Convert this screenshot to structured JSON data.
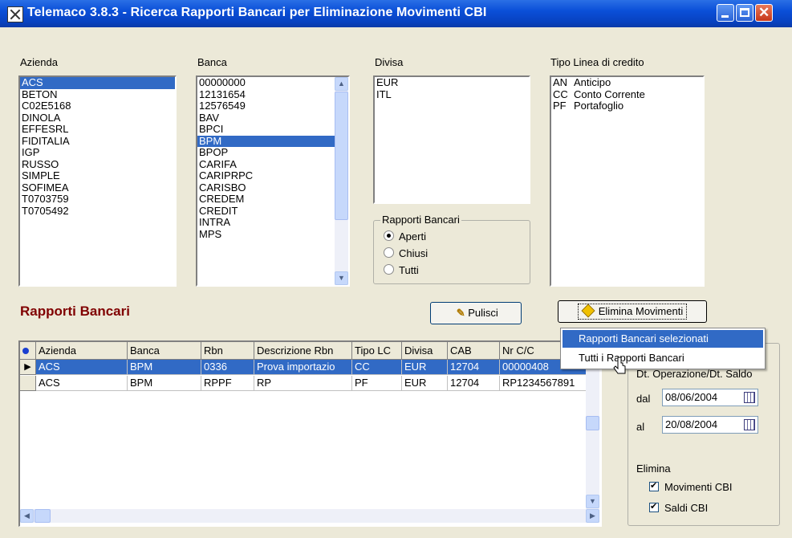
{
  "window": {
    "title": "Telemaco 3.8.3  - Ricerca Rapporti Bancari per Eliminazione Movimenti CBI"
  },
  "azienda": {
    "label": "Azienda",
    "items": [
      "ACS",
      "BETON",
      "C02E5168",
      "DINOLA",
      "EFFESRL",
      "FIDITALIA",
      "IGP",
      "RUSSO",
      "SIMPLE",
      "SOFIMEA",
      "T0703759",
      "T0705492"
    ],
    "selected": "ACS"
  },
  "banca": {
    "label": "Banca",
    "items": [
      "00000000",
      "12131654",
      "12576549",
      "BAV",
      "BPCI",
      "BPM",
      "BPOP",
      "CARIFA",
      "CARIPRPC",
      "CARISBO",
      "CREDEM",
      "CREDIT",
      "INTRA",
      "MPS"
    ],
    "selected": "BPM"
  },
  "divisa": {
    "label": "Divisa",
    "items": [
      "EUR",
      "ITL"
    ]
  },
  "tipo_linea": {
    "label": "Tipo Linea di credito",
    "items": [
      {
        "code": "AN",
        "desc": "Anticipo"
      },
      {
        "code": "CC",
        "desc": "Conto Corrente"
      },
      {
        "code": "PF",
        "desc": "Portafoglio"
      }
    ]
  },
  "rapporti_group": {
    "title": "Rapporti Bancari",
    "options": [
      "Aperti",
      "Chiusi",
      "Tutti"
    ],
    "selected": "Aperti"
  },
  "section_title": "Rapporti Bancari",
  "buttons": {
    "pulisci": "Pulisci",
    "elimina": "Elimina Movimenti"
  },
  "grid": {
    "columns": [
      "Azienda",
      "Banca",
      "Rbn",
      "Descrizione Rbn",
      "Tipo LC",
      "Divisa",
      "CAB",
      "Nr C/C"
    ],
    "rows": [
      [
        "ACS",
        "BPM",
        "0336",
        "Prova importazio",
        "CC",
        "EUR",
        "12704",
        "00000408"
      ],
      [
        "ACS",
        "BPM",
        "RPPF",
        "RP",
        "PF",
        "EUR",
        "12704",
        "RP1234567891"
      ]
    ],
    "selected_row": 0
  },
  "popup_menu": {
    "items": [
      "Rapporti Bancari selezionati",
      "Tutti i Rapporti Bancari"
    ],
    "highlighted": 0
  },
  "filter": {
    "date_label": "Dt. Operazione/Dt. Saldo",
    "dal_label": "dal",
    "dal_value": "08/06/2004",
    "al_label": "al",
    "al_value": "20/08/2004",
    "elimina_label": "Elimina",
    "checks": [
      "Movimenti CBI",
      "Saldi CBI"
    ]
  },
  "colors": {
    "selection": "#316ac5",
    "section_title": "#800000",
    "titlebar": "#0a4fd8"
  }
}
